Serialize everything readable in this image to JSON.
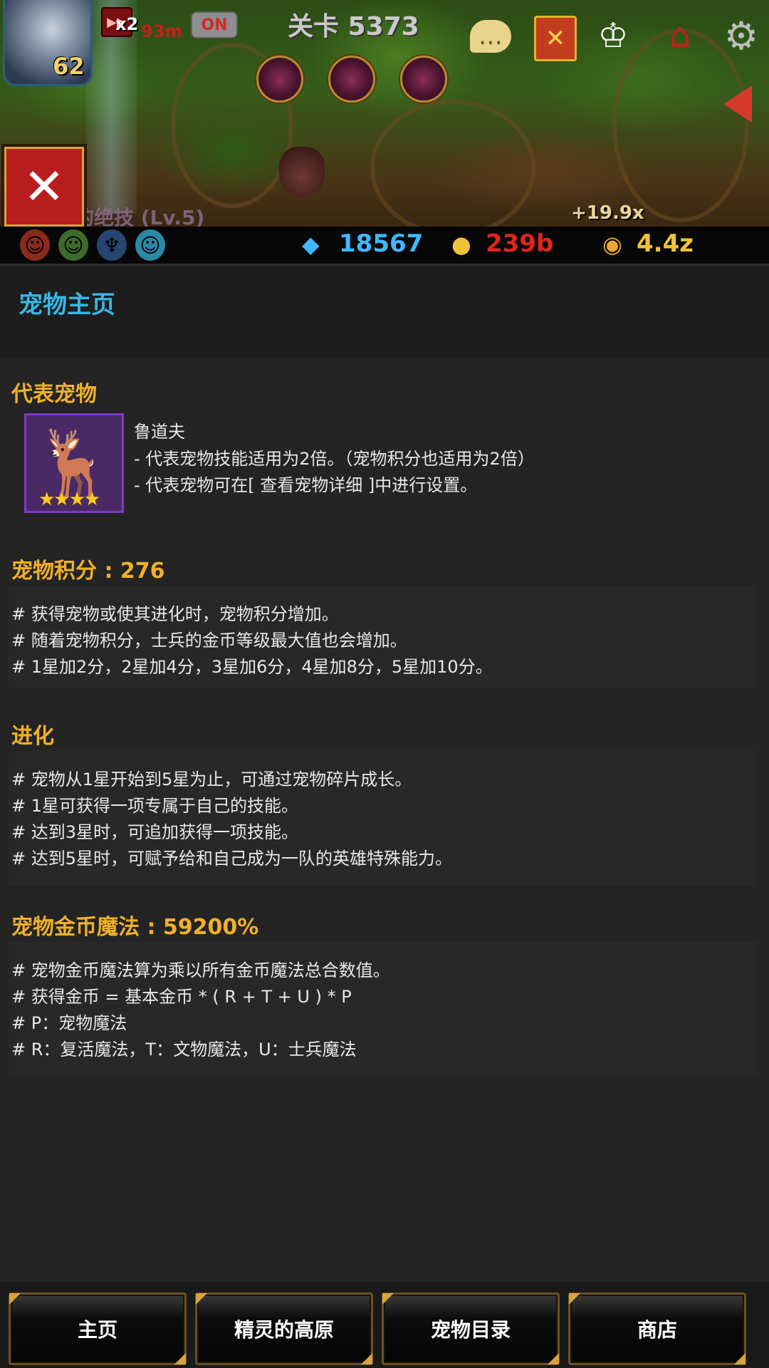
{
  "hud": {
    "hero_level": "62",
    "speed_multiplier": "x2",
    "speed_time": "93m",
    "auto_toggle": "ON",
    "stage_label": "关卡 5373",
    "skill_text": "的绝技 (Lv.5)",
    "dps_text": "+19.9x"
  },
  "resources": {
    "gems": "18567",
    "medals": "239b",
    "gold": "4.4z",
    "colors": {
      "gems": "#3fb8ff",
      "medals": "#e0241c",
      "gold": "#f0c23a"
    }
  },
  "panel": {
    "title": "宠物主页"
  },
  "representative": {
    "title": "代表宠物",
    "pet_name": "鲁道夫",
    "lines": [
      " - 代表宠物技能适用为2倍。（宠物积分也适用为2倍）",
      " - 代表宠物可在[ 查看宠物详细 ]中进行设置。"
    ],
    "stars": "★★★★"
  },
  "pet_score": {
    "title": "宠物积分 : 276",
    "lines": [
      "# 获得宠物或使其进化时，宠物积分增加。",
      "# 随着宠物积分，士兵的金币等级最大值也会增加。",
      "# 1星加2分，2星加4分，3星加6分，4星加8分，5星加10分。"
    ]
  },
  "evolution": {
    "title": "进化",
    "lines": [
      "# 宠物从1星开始到5星为止，可通过宠物碎片成长。",
      "# 1星可获得一项专属于自己的技能。",
      "# 达到3星时，可追加获得一项技能。",
      "# 达到5星时，可赋予给和自己成为一队的英雄特殊能力。"
    ]
  },
  "gold_magic": {
    "title": "宠物金币魔法 : 59200%",
    "lines": [
      "# 宠物金币魔法算为乘以所有金币魔法总合数值。",
      "# 获得金币 = 基本金币 * ( R + T + U ) * P",
      "# P：宠物魔法",
      "# R：复活魔法，T：文物魔法，U：士兵魔法"
    ]
  },
  "nav": {
    "home": "主页",
    "elf_plateau": "精灵的高原",
    "pet_catalog": "宠物目录",
    "shop": "商店"
  },
  "accent": {
    "section_title": "#f0b02a",
    "panel_title": "#39b6e6"
  }
}
